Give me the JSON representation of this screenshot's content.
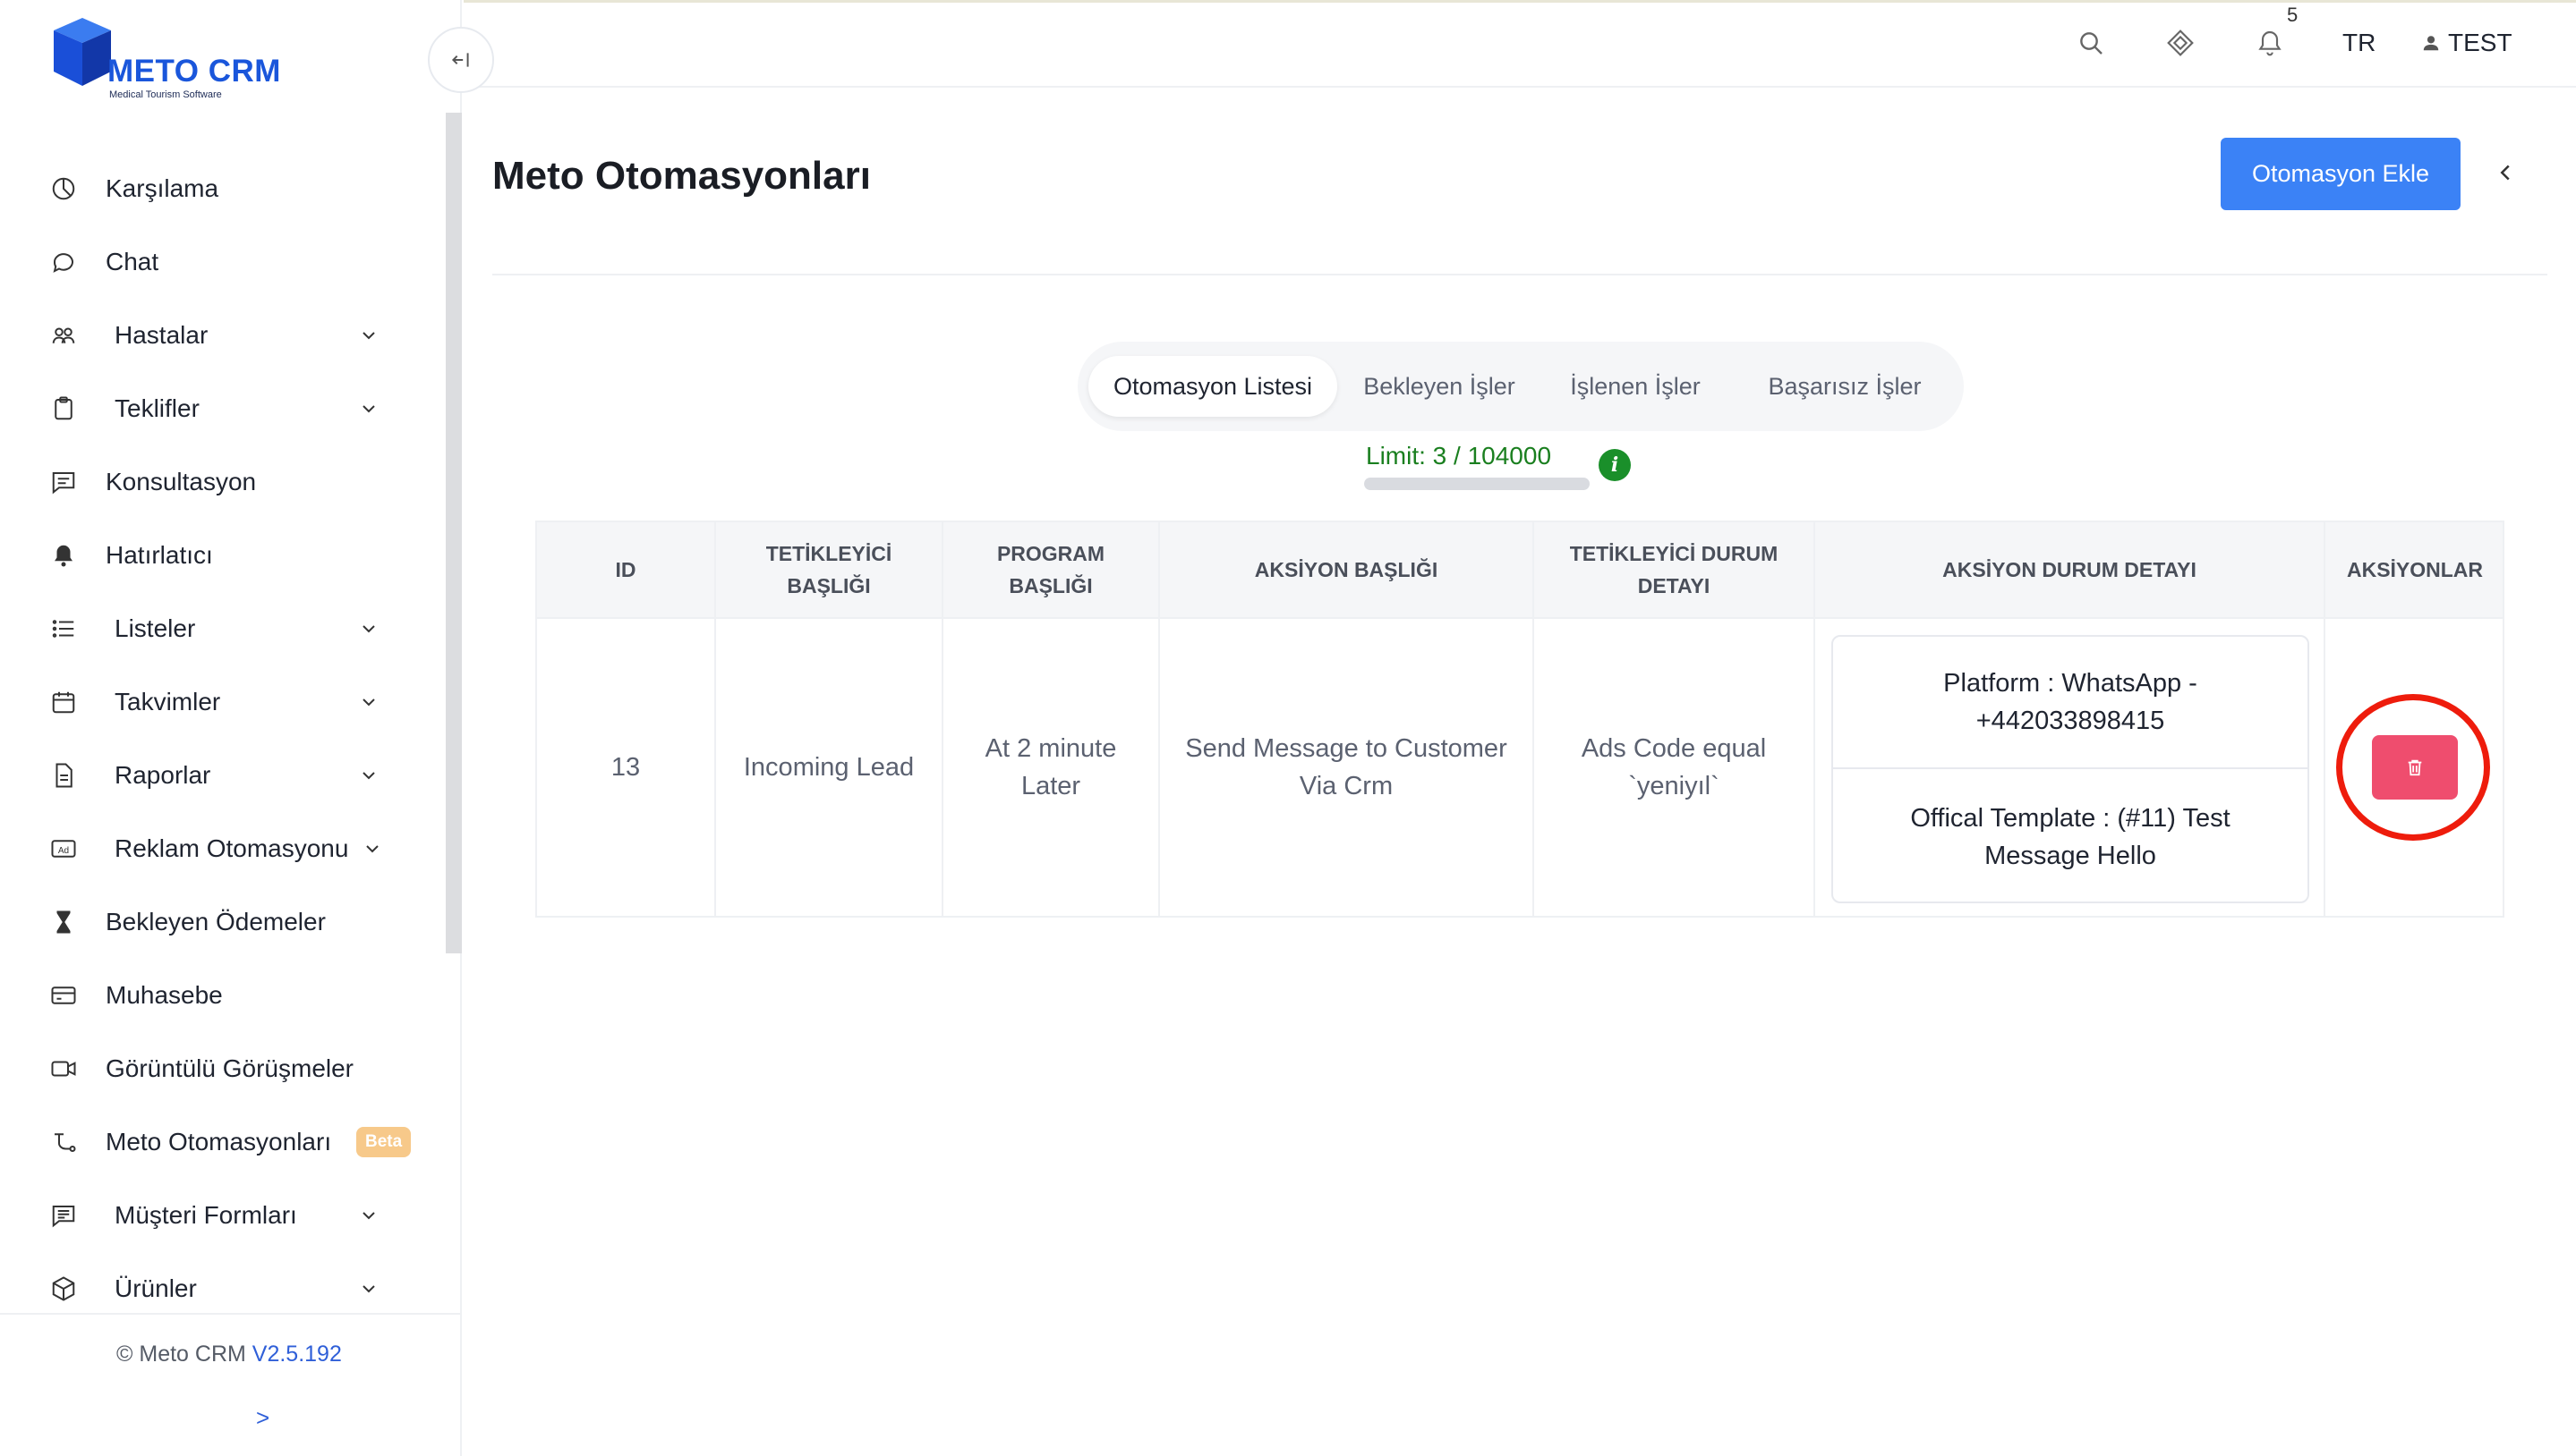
{
  "brand": {
    "name": "METO CRM",
    "tagline": "Medical Tourism Software",
    "color": "#1a56db"
  },
  "sidebar": {
    "items": [
      {
        "label": "Karşılama",
        "icon": "dashboard-icon",
        "expandable": false
      },
      {
        "label": "Chat",
        "icon": "chat-bubble-icon",
        "expandable": false
      },
      {
        "label": "Hastalar",
        "icon": "users-icon",
        "expandable": true
      },
      {
        "label": "Teklifler",
        "icon": "clipboard-icon",
        "expandable": true
      },
      {
        "label": "Konsultasyon",
        "icon": "message-square-icon",
        "expandable": false
      },
      {
        "label": "Hatırlatıcı",
        "icon": "bell-icon",
        "expandable": false
      },
      {
        "label": "Listeler",
        "icon": "list-icon",
        "expandable": true
      },
      {
        "label": "Takvimler",
        "icon": "calendar-icon",
        "expandable": true
      },
      {
        "label": "Raporlar",
        "icon": "document-icon",
        "expandable": true
      },
      {
        "label": "Reklam Otomasyonu",
        "icon": "ad-icon",
        "expandable": true
      },
      {
        "label": "Bekleyen Ödemeler",
        "icon": "hourglass-icon",
        "expandable": false
      },
      {
        "label": "Muhasebe",
        "icon": "credit-card-icon",
        "expandable": false
      },
      {
        "label": "Görüntülü Görüşmeler",
        "icon": "video-icon",
        "expandable": false
      },
      {
        "label": "Meto Otomasyonları",
        "icon": "workflow-icon",
        "expandable": false,
        "badge": "Beta"
      },
      {
        "label": "Müşteri Formları",
        "icon": "form-icon",
        "expandable": true
      },
      {
        "label": "Ürünler",
        "icon": "box-icon",
        "expandable": true
      }
    ],
    "footer": {
      "copyright": "© Meto CRM",
      "version": "V2.5.192",
      "arrow": ">"
    }
  },
  "topbar": {
    "notification_count": "5",
    "language": "TR",
    "user": "TEST"
  },
  "main": {
    "title": "Meto Otomasyonları",
    "add_button": "Otomasyon Ekle",
    "tabs": [
      {
        "label": "Otomasyon Listesi",
        "active": true
      },
      {
        "label": "Bekleyen İşler",
        "active": false
      },
      {
        "label": "İşlenen İşler",
        "active": false
      },
      {
        "label": "Başarısız İşler",
        "active": false
      }
    ],
    "limit": {
      "text": "Limit: 3 / 104000",
      "used": 3,
      "total": 104000,
      "info_icon": "i"
    },
    "table": {
      "headers": [
        "ID",
        "TETİKLEYİCİ BAŞLIĞI",
        "PROGRAM BAŞLIĞI",
        "AKSİYON BAŞLIĞI",
        "TETİKLEYİCİ DURUM DETAYI",
        "AKSİYON DURUM DETAYI",
        "AKSİYONLAR"
      ],
      "rows": [
        {
          "id": "13",
          "trigger_title": "Incoming Lead",
          "program_title": "At 2 minute Later",
          "action_title": "Send Message to Customer Via Crm",
          "trigger_status": "Ads Code equal `yeniyıl`",
          "action_detail_1": "Platform : WhatsApp - +442033898415",
          "action_detail_2": "Offical Template : (#11) Test Message Hello"
        }
      ]
    }
  },
  "colors": {
    "primary": "#3b82f6",
    "danger": "#ef4d6e",
    "success": "#1a7f1f",
    "highlight": "#ee1c0c"
  }
}
